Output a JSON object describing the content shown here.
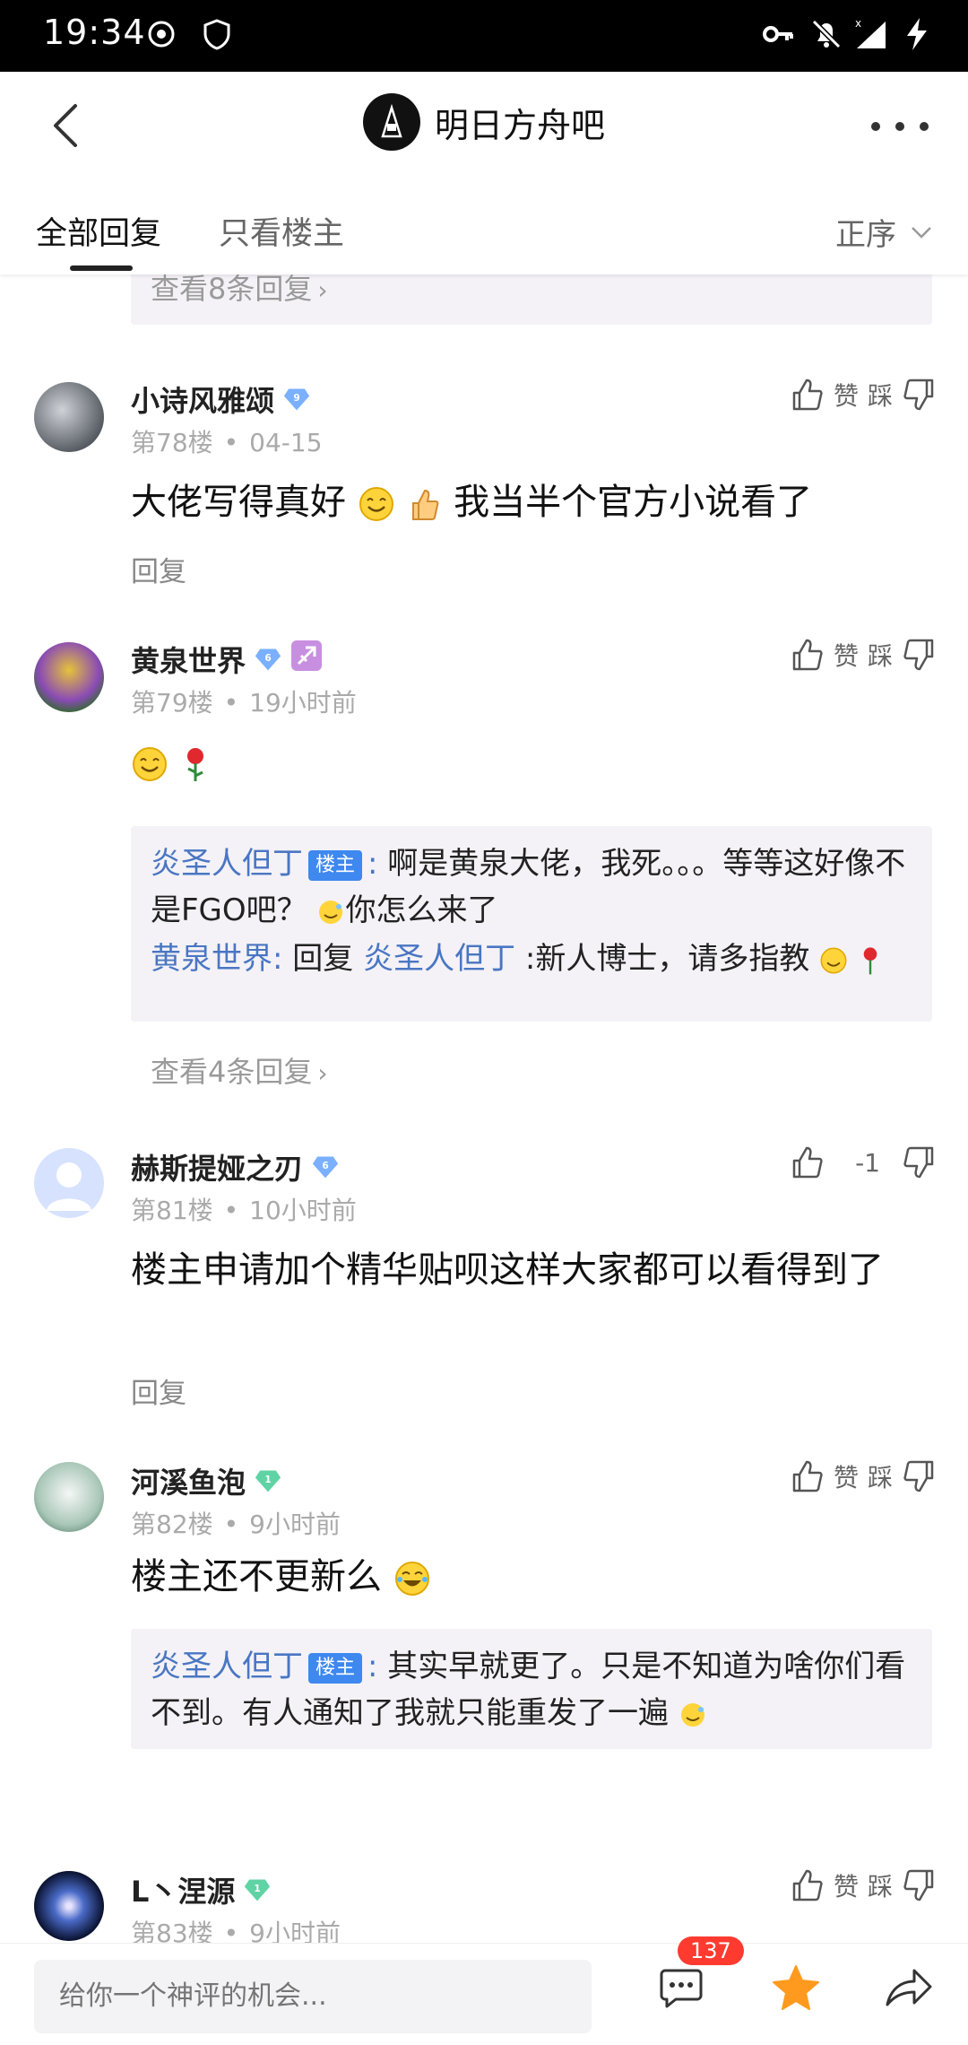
{
  "status_bar": {
    "time": "19:34"
  },
  "header": {
    "forum_name": "明日方舟吧"
  },
  "tabs": {
    "all_replies": "全部回复",
    "only_op": "只看楼主",
    "sort": "正序"
  },
  "top_partial": {
    "view_more": "查看8条回复"
  },
  "posts": [
    {
      "username": "小诗风雅颂",
      "level": "9",
      "floor": "第78楼",
      "time": "04-15",
      "content": "大佬写得真好",
      "content_tail": "我当半个官方小说看了",
      "reply": "回复",
      "like": "赞",
      "dislike": "踩"
    },
    {
      "username": "黄泉世界",
      "level": "6",
      "floor": "第79楼",
      "time": "19小时前",
      "like": "赞",
      "dislike": "踩",
      "sub_replies": [
        {
          "author": "炎圣人但丁",
          "tag": "楼主",
          "text": "啊是黄泉大佬，我死。。。等等这好像不是FGO吧？",
          "tail": "你怎么来了"
        },
        {
          "author": "黄泉世界",
          "reply_prefix": "回复",
          "reply_to": "炎圣人但丁",
          "text": ":新人博士，请多指教"
        }
      ],
      "view_more": "查看4条回复"
    },
    {
      "username": "赫斯提娅之刃",
      "level": "6",
      "floor": "第81楼",
      "time": "10小时前",
      "content": "楼主申请加个精华贴呗这样大家都可以看得到了",
      "reply": "回复",
      "vote_count": "-1"
    },
    {
      "username": "河溪鱼泡",
      "level": "1",
      "floor": "第82楼",
      "time": "9小时前",
      "content": "楼主还不更新么",
      "like": "赞",
      "dislike": "踩",
      "sub_replies": [
        {
          "author": "炎圣人但丁",
          "tag": "楼主",
          "text": "其实早就更了。只是不知道为啥你们看不到。有人通知了我就只能重发了一遍"
        }
      ]
    },
    {
      "username": "L丶涅源",
      "level": "1",
      "floor": "第83楼",
      "time": "9小时前",
      "like": "赞",
      "dislike": "踩"
    }
  ],
  "bottom_bar": {
    "placeholder": "给你一个神评的机会...",
    "comment_count": "137"
  },
  "colors": {
    "link": "#4a76c2",
    "op_tag": "#3e88f0",
    "badge": "#ff3b30",
    "star": "#ff9a1f"
  }
}
